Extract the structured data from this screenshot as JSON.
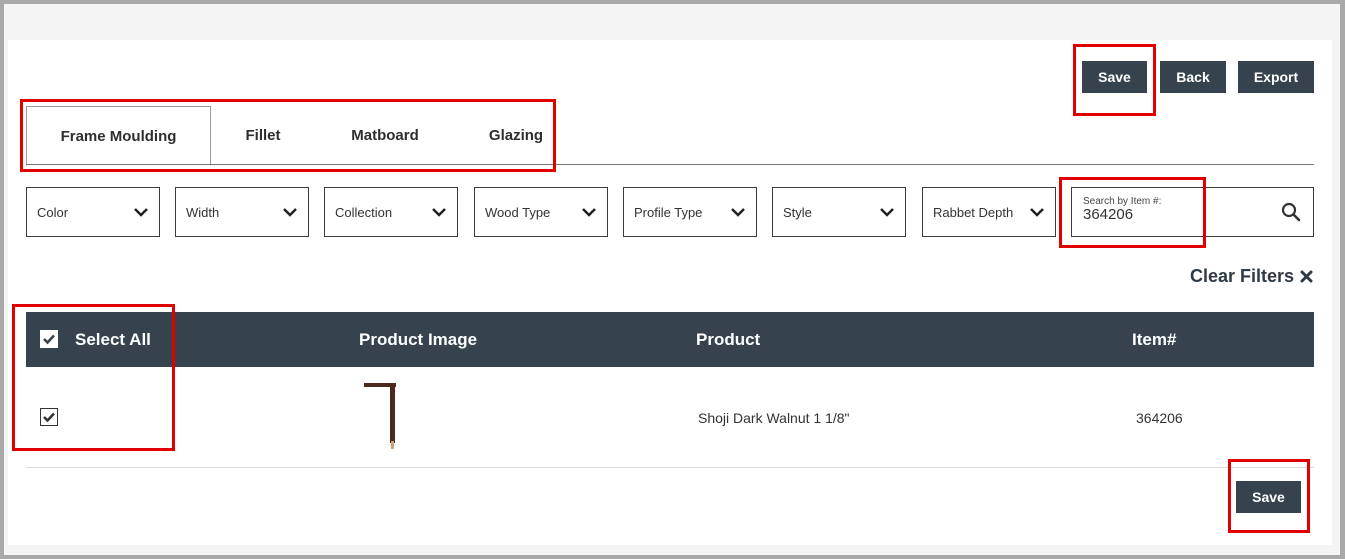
{
  "toolbar": {
    "save_label": "Save",
    "back_label": "Back",
    "export_label": "Export"
  },
  "tabs": [
    {
      "label": "Frame Moulding",
      "active": true
    },
    {
      "label": "Fillet",
      "active": false
    },
    {
      "label": "Matboard",
      "active": false
    },
    {
      "label": "Glazing",
      "active": false
    }
  ],
  "filters": [
    {
      "label": "Color"
    },
    {
      "label": "Width"
    },
    {
      "label": "Collection"
    },
    {
      "label": "Wood Type"
    },
    {
      "label": "Profile Type"
    },
    {
      "label": "Style"
    },
    {
      "label": "Rabbet Depth"
    }
  ],
  "search": {
    "placeholder": "Search by Item #:",
    "value": "364206"
  },
  "clear_filters_label": "Clear Filters",
  "table": {
    "columns": [
      "Select All",
      "Product Image",
      "Product",
      "Item#"
    ],
    "rows": [
      {
        "checked": true,
        "product": "Shoji Dark Walnut 1 1/8\"",
        "item": "364206"
      }
    ]
  },
  "footer": {
    "save_label": "Save"
  },
  "colors": {
    "header_bg": "#36434f",
    "highlight": "#e00000",
    "moulding_brown": "#4a2a1c"
  }
}
